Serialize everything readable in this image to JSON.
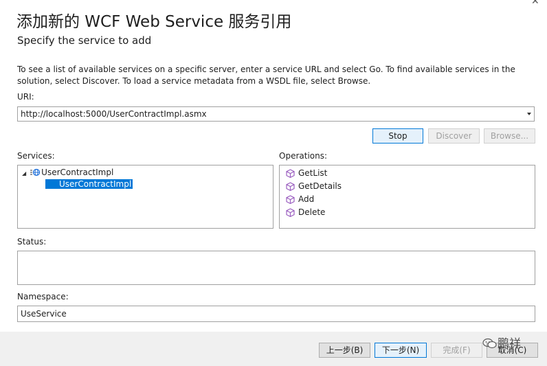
{
  "header": {
    "title": "添加新的 WCF Web Service 服务引用",
    "subtitle": "Specify the service to add"
  },
  "description": "To see a list of available services on a specific server, enter a service URL and select Go. To find available services in the solution, select Discover.  To load a service metadata from a WSDL file, select Browse.",
  "uri": {
    "label": "URI:",
    "value": "http://localhost:5000/UserContractImpl.asmx"
  },
  "buttons": {
    "stop": "Stop",
    "discover": "Discover",
    "browse": "Browse...",
    "back": "上一步(B)",
    "next": "下一步(N)",
    "finish": "完成(F)",
    "cancel": "取消(C)"
  },
  "services": {
    "label": "Services:",
    "root": "UserContractImpl",
    "child": "UserContractImpl"
  },
  "operations": {
    "label": "Operations:",
    "items": [
      "GetList",
      "GetDetails",
      "Add",
      "Delete"
    ]
  },
  "status": {
    "label": "Status:",
    "text": ""
  },
  "namespace": {
    "label": "Namespace:",
    "value": "UseService"
  },
  "watermark": "鹏祥",
  "colors": {
    "accent": "#0078d7",
    "icon_purple": "#9b5fc0",
    "globe_blue": "#1e6fd9"
  }
}
